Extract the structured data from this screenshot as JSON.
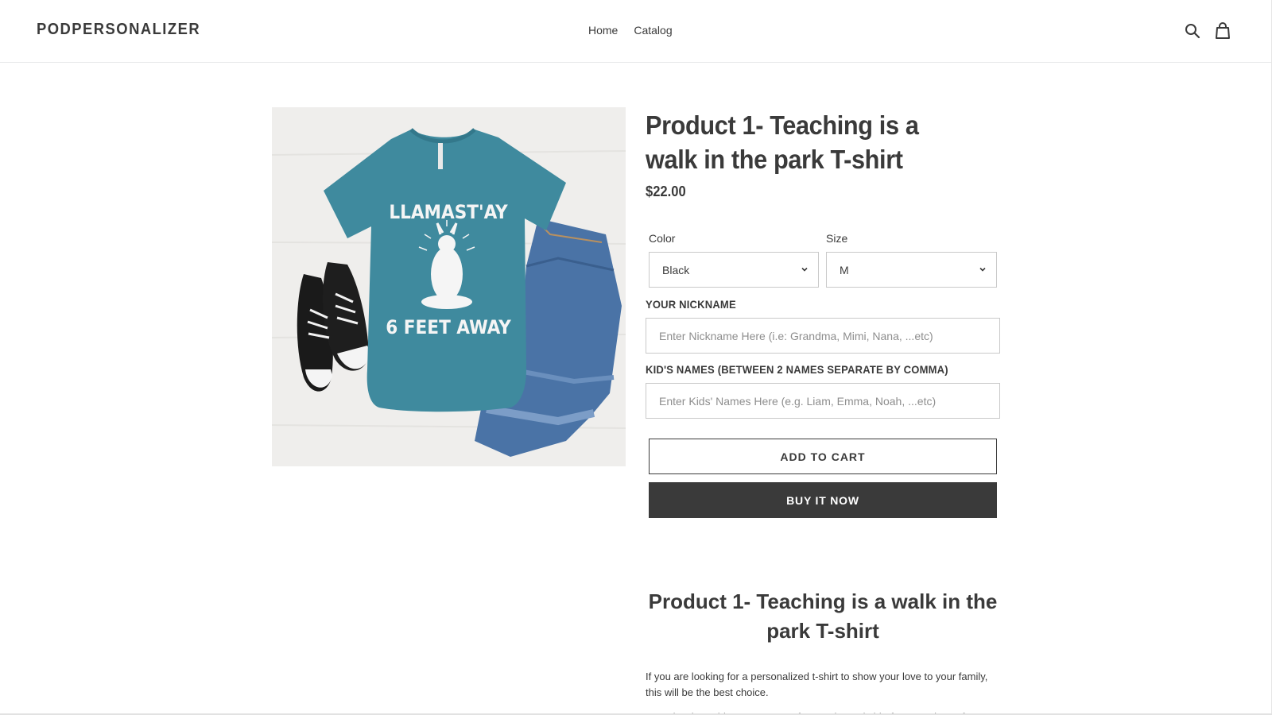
{
  "header": {
    "logo": "PODPERSONALIZER",
    "nav": [
      {
        "label": "Home"
      },
      {
        "label": "Catalog"
      }
    ],
    "icons": [
      "search-icon",
      "cart-icon"
    ]
  },
  "product": {
    "title": "Product 1- Teaching is a walk in the park T-shirt",
    "price": "$22.00",
    "image": {
      "shirt_text_top": "LLAMAST'AY",
      "shirt_text_bottom": "6 FEET AWAY",
      "shirt_color": "#3f8a9e"
    },
    "options": {
      "color": {
        "label": "Color",
        "value": "Black"
      },
      "size": {
        "label": "Size",
        "value": "M"
      }
    },
    "fields": {
      "nickname": {
        "label": "YOUR NICKNAME",
        "placeholder": "Enter Nickname Here (i.e: Grandma, Mimi, Nana, ...etc)"
      },
      "kids": {
        "label": "KID'S NAMES (BETWEEN 2 NAMES SEPARATE BY COMMA)",
        "placeholder": "Enter Kids' Names Here (e.g. Liam, Emma, Noah, ...etc)"
      }
    },
    "buttons": {
      "add_to_cart": "ADD TO CART",
      "buy_now": "BUY IT NOW"
    },
    "description": {
      "title": "Product 1- Teaching is a walk in the park T-shirt",
      "text": "If you are looking for a personalized t-shirt to show your love to your family, this will be the best choice.",
      "text_cut": "Our Classic T-Shirt are cotton, soft, stretchy and shirt for your piece of"
    }
  },
  "colors": {
    "text": "#3a3a3a",
    "button_dark": "#3a3a3a",
    "border": "#c9c9c9"
  }
}
